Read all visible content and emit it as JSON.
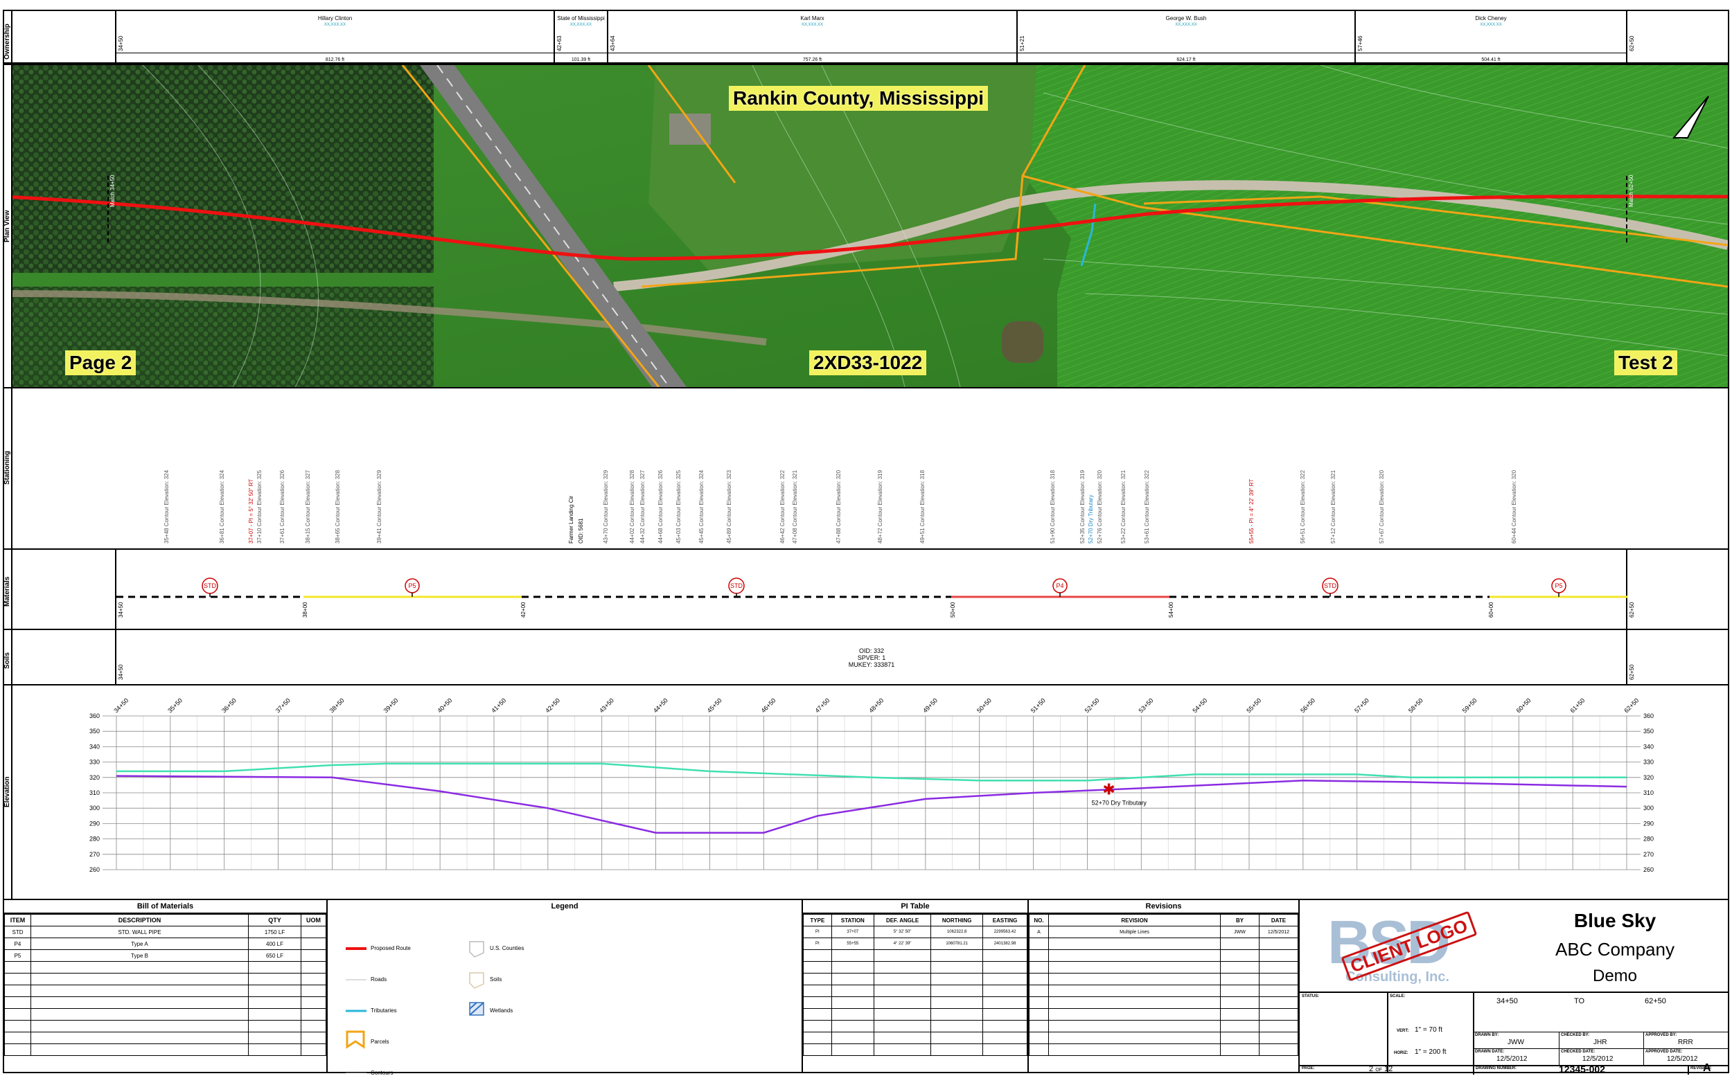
{
  "ownership": {
    "label": "Ownership",
    "parcels": [
      {
        "name": "Hillary Clinton",
        "id": "XX,XXX.XX",
        "length": "812.76 ft",
        "start": "34+50"
      },
      {
        "name": "State of Mississippi",
        "id": "XX,XXX.XX",
        "length": "101.39 ft",
        "start": "42+63"
      },
      {
        "name": "Karl Marx",
        "id": "XX,XXX.XX",
        "length": "757.26 ft",
        "start": "43+64"
      },
      {
        "name": "George W. Bush",
        "id": "XX,XXX.XX",
        "length": "624.17 ft",
        "start": "51+21"
      },
      {
        "name": "Dick Cheney",
        "id": "XX,XXX.XX",
        "length": "504.41 ft",
        "start": "57+46"
      }
    ],
    "end": "62+50"
  },
  "plan_view": {
    "label": "Plan View",
    "county": "Rankin County, Mississippi",
    "page": "Page 2",
    "center_label": "2XD33-1022",
    "right_label": "Test 2",
    "match_left": "Match 34+50",
    "match_right": "Match 62+50"
  },
  "stationing": {
    "label": "Stationing",
    "items": [
      {
        "text": "35+48 Contour Elevation: 324",
        "color": "#555555"
      },
      {
        "text": "36+81 Contour Elevation: 324",
        "color": "#555555"
      },
      {
        "text": "37+07 - PI = 5° 32' 50\" RT",
        "color": "#cc0000"
      },
      {
        "text": "37+10 Contour Elevation: 325",
        "color": "#555555"
      },
      {
        "text": "37+61 Contour Elevation: 326",
        "color": "#555555"
      },
      {
        "text": "38+15 Contour Elevation: 327",
        "color": "#555555"
      },
      {
        "text": "38+65 Contour Elevation: 328",
        "color": "#555555"
      },
      {
        "text": "39+41 Contour Elevation: 329",
        "color": "#555555"
      },
      {
        "text": "Farmer Landing Cir",
        "color": "#000000"
      },
      {
        "text": "OID: 5681",
        "color": "#000000"
      },
      {
        "text": "43+70 Contour Elevation: 329",
        "color": "#555555"
      },
      {
        "text": "44+02 Contour Elevation: 328",
        "color": "#555555"
      },
      {
        "text": "44+32 Contour Elevation: 327",
        "color": "#555555"
      },
      {
        "text": "44+68 Contour Elevation: 326",
        "color": "#555555"
      },
      {
        "text": "45+03 Contour Elevation: 325",
        "color": "#555555"
      },
      {
        "text": "45+45 Contour Elevation: 324",
        "color": "#555555"
      },
      {
        "text": "45+89 Contour Elevation: 323",
        "color": "#555555"
      },
      {
        "text": "46+42 Contour Elevation: 322",
        "color": "#555555"
      },
      {
        "text": "47+08 Contour Elevation: 321",
        "color": "#555555"
      },
      {
        "text": "47+88 Contour Elevation: 320",
        "color": "#555555"
      },
      {
        "text": "48+72 Contour Elevation: 319",
        "color": "#555555"
      },
      {
        "text": "49+51 Contour Elevation: 318",
        "color": "#555555"
      },
      {
        "text": "51+90 Contour Elevation: 318",
        "color": "#555555"
      },
      {
        "text": "52+35 Contour Elevation: 319",
        "color": "#555555"
      },
      {
        "text": "52+70 Dry Tributary",
        "color": "#1e88c8"
      },
      {
        "text": "52+76 Contour Elevation: 320",
        "color": "#555555"
      },
      {
        "text": "53+22 Contour Elevation: 321",
        "color": "#555555"
      },
      {
        "text": "53+61 Contour Elevation: 322",
        "color": "#555555"
      },
      {
        "text": "55+55 - PI = 4° 22' 39\" RT",
        "color": "#cc0000"
      },
      {
        "text": "56+51 Contour Elevation: 322",
        "color": "#555555"
      },
      {
        "text": "57+12 Contour Elevation: 321",
        "color": "#555555"
      },
      {
        "text": "57+67 Contour Elevation: 320",
        "color": "#555555"
      },
      {
        "text": "60+44 Contour Elevation: 320",
        "color": "#555555"
      }
    ]
  },
  "materials": {
    "label": "Materials",
    "markers": [
      "STD",
      "P5",
      "STD",
      "P4",
      "STD",
      "P5"
    ],
    "stations": [
      "34+50",
      "38+00",
      "42+00",
      "50+00",
      "54+00",
      "60+00",
      "62+50"
    ]
  },
  "soils": {
    "label": "Soils",
    "lines": [
      "OID: 332",
      "SPVER: 1",
      "MUKEY: 333871"
    ],
    "start": "34+50",
    "end": "62+50"
  },
  "elevation": {
    "label": "Elevation",
    "annotation": "52+70 Dry Tributary"
  },
  "chart_data": {
    "type": "line",
    "x_ticks": [
      "34+50",
      "35+50",
      "36+50",
      "37+50",
      "38+50",
      "39+50",
      "40+50",
      "41+50",
      "42+50",
      "43+50",
      "44+50",
      "45+50",
      "46+50",
      "47+50",
      "48+50",
      "49+50",
      "50+50",
      "51+50",
      "52+50",
      "53+50",
      "54+50",
      "55+50",
      "56+50",
      "57+50",
      "58+50",
      "59+50",
      "60+50",
      "61+50",
      "62+50"
    ],
    "ylim": [
      260,
      360
    ],
    "y_ticks": [
      360,
      350,
      340,
      330,
      320,
      310,
      300,
      290,
      280,
      270,
      260
    ],
    "grid": true,
    "series": [
      {
        "color": "#40e0b0",
        "points": [
          [
            0,
            324
          ],
          [
            2,
            324
          ],
          [
            4,
            328
          ],
          [
            5,
            329
          ],
          [
            9,
            329
          ],
          [
            11,
            324
          ],
          [
            14,
            320
          ],
          [
            16,
            318
          ],
          [
            18,
            318
          ],
          [
            20,
            322
          ],
          [
            23,
            322
          ],
          [
            24,
            320
          ],
          [
            28,
            320
          ]
        ]
      },
      {
        "color": "#8a2be2",
        "points": [
          [
            0,
            321
          ],
          [
            4,
            320
          ],
          [
            6,
            311
          ],
          [
            8,
            300
          ],
          [
            9,
            292
          ],
          [
            10,
            284
          ],
          [
            12,
            284
          ],
          [
            13,
            295
          ],
          [
            15,
            306
          ],
          [
            17,
            310
          ],
          [
            19,
            313
          ],
          [
            22,
            318
          ],
          [
            24,
            317
          ],
          [
            28,
            314
          ]
        ]
      }
    ],
    "marker": {
      "x": 18.4,
      "y": 312
    }
  },
  "bill_of_materials": {
    "title": "Bill of Materials",
    "headers": [
      "ITEM",
      "DESCRIPTION",
      "QTY",
      "UOM"
    ],
    "rows": [
      [
        "STD",
        "STD. WALL PIPE",
        "1750 LF",
        ""
      ],
      [
        "P4",
        "Type A",
        "400 LF",
        ""
      ],
      [
        "P5",
        "Type B",
        "650 LF",
        ""
      ]
    ]
  },
  "legend": {
    "title": "Legend",
    "left": [
      "Proposed Route",
      "Roads",
      "Tributaries",
      "Parcels",
      "Contours"
    ],
    "right": [
      "U.S. Counties",
      "Soils",
      "Wetlands"
    ]
  },
  "pi_table": {
    "title": "PI Table",
    "headers": [
      "TYPE",
      "STATION",
      "DEF. ANGLE",
      "NORTHING",
      "EASTING"
    ],
    "rows": [
      [
        "PI",
        "37+07",
        "5° 32' 50\"",
        "1062322.8",
        "2299563.42"
      ],
      [
        "PI",
        "55+55",
        "4° 22' 39\"",
        "1060781.21",
        "2401382.98"
      ]
    ]
  },
  "revisions": {
    "title": "Revisions",
    "headers": [
      "NO.",
      "REVISION",
      "BY",
      "DATE"
    ],
    "rows": [
      [
        "A",
        "Multiple Lines",
        "JWW",
        "12/5/2012"
      ]
    ]
  },
  "title_block": {
    "logo_letters": "BSD",
    "logo_stamp": "CLIENT LOGO",
    "logo_sub": "Consulting, Inc.",
    "company1": "Blue Sky",
    "company2": "ABC Company",
    "company3": "Demo",
    "status_label": "STATUS:",
    "scale_label": "SCALE:",
    "range_from": "34+50",
    "range_to_label": "TO",
    "range_to": "62+50",
    "vert_label": "VERT:",
    "vert_value": "1\" = 70 ft",
    "horiz_label": "HORIZ:",
    "horiz_value": "1\" = 200 ft",
    "drawn_by_label": "DRAWN BY:",
    "drawn_by": "JWW",
    "checked_by_label": "CHECKED BY:",
    "checked_by": "JHR",
    "approved_by_label": "APPROVED BY:",
    "approved_by": "RRR",
    "drawn_date_label": "DRAWN DATE:",
    "drawn_date": "12/5/2012",
    "checked_date_label": "CHECKED DATE:",
    "checked_date": "12/5/2012",
    "approved_date_label": "APPROVED DATE:",
    "approved_date": "12/5/2012",
    "page_label": "PAGE:",
    "page_num": "2",
    "page_of": "OF",
    "page_total": "12",
    "drawing_number_label": "DRAWING NUMBER:",
    "drawing_number": "12345-002",
    "revision_label": "REVISION:",
    "revision": "A"
  }
}
